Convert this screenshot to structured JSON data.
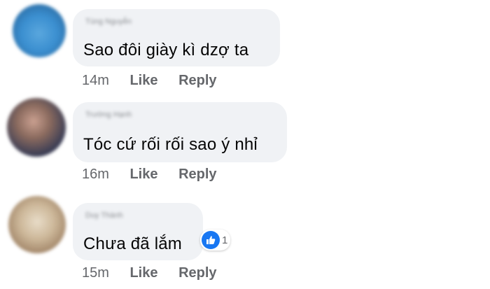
{
  "comments": [
    {
      "author": "Tùng Nguyễn",
      "text": "Sao đôi giày kì dzợ ta",
      "time": "14m",
      "like_label": "Like",
      "reply_label": "Reply",
      "avatar_color": "#3b8fd0"
    },
    {
      "author": "Trường Hạnh",
      "text": "Tóc cứ rối rối sao ý nhỉ",
      "time": "16m",
      "like_label": "Like",
      "reply_label": "Reply",
      "avatar_color": "#6b5a55"
    },
    {
      "author": "Duy Thành",
      "text": "Chưa đã lắm",
      "time": "15m",
      "like_label": "Like",
      "reply_label": "Reply",
      "avatar_color": "#b9a48a",
      "reaction": {
        "icon": "thumbs-up-icon",
        "count": "1"
      }
    }
  ],
  "colors": {
    "bubble": "#f0f2f5",
    "meta_text": "#65676b",
    "like_blue": "#1877f2"
  }
}
